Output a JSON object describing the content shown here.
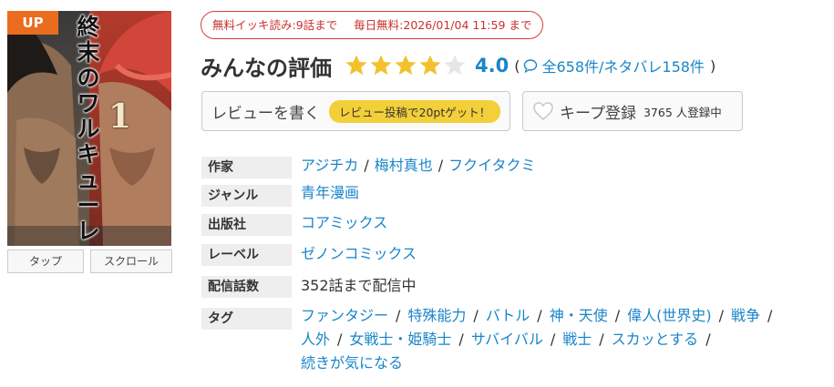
{
  "cover": {
    "badge": "UP",
    "title_vertical": [
      "終",
      "末",
      "の",
      "ワ",
      "ル",
      "キ",
      "ュ",
      "ー",
      "レ"
    ],
    "volume": "1",
    "buttons": {
      "tap": "タップ",
      "scroll": "スクロール"
    }
  },
  "free_notice": {
    "ikki": "無料イッキ読み:9話まで",
    "daily": "毎日無料:2026/01/04 11:59 まで"
  },
  "rating": {
    "title": "みんなの評価",
    "stars_filled": 4,
    "stars_total": 5,
    "score": "4.0",
    "open_paren": "(",
    "review_count": "全658件",
    "spoiler_count": "/ネタバレ158件",
    "close_paren": ")"
  },
  "review": {
    "label": "レビューを書く",
    "promo": "レビュー投稿で20ptゲット！"
  },
  "keep": {
    "label": "キープ登録",
    "count": "3765 人登録中"
  },
  "info": {
    "author_label": "作家",
    "authors": [
      "アジチカ",
      "梅村真也",
      "フクイタクミ"
    ],
    "genre_label": "ジャンル",
    "genre": "青年漫画",
    "publisher_label": "出版社",
    "publisher": "コアミックス",
    "label_label": "レーベル",
    "label": "ゼノンコミックス",
    "episodes_label": "配信話数",
    "episodes": "352話まで配信中",
    "tags_label": "タグ",
    "tags": [
      "ファンタジー",
      "特殊能力",
      "バトル",
      "神・天使",
      "偉人(世界史)",
      "戦争",
      "人外",
      "女戦士・姫騎士",
      "サバイバル",
      "戦士",
      "スカッとする",
      "続きが気になる"
    ]
  },
  "colors": {
    "link": "#1a85c9",
    "badge": "#ec6c1f",
    "notice": "#c8312d",
    "star": "#f3c12c",
    "promo": "#f3cf3a"
  }
}
